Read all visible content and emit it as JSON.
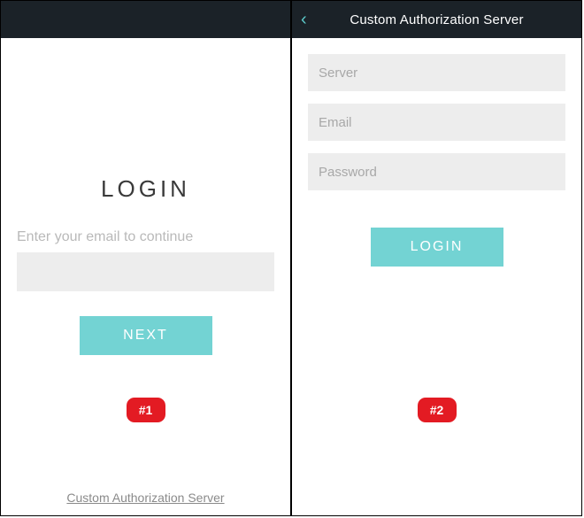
{
  "screen1": {
    "header": {
      "title": ""
    },
    "login_title": "LOGIN",
    "prompt_label": "Enter your email to continue",
    "email_input": {
      "value": "",
      "placeholder": ""
    },
    "next_button_label": "NEXT",
    "bottom_link_label": "Custom Authorization Server",
    "badge_label": "#1"
  },
  "screen2": {
    "header": {
      "title": "Custom Authorization Server",
      "back_icon": "‹"
    },
    "server_input": {
      "value": "",
      "placeholder": "Server"
    },
    "email_input": {
      "value": "",
      "placeholder": "Email"
    },
    "password_input": {
      "value": "",
      "placeholder": "Password"
    },
    "login_button_label": "LOGIN",
    "badge_label": "#2"
  },
  "colors": {
    "header_bg": "#1b2228",
    "accent": "#73d3d3",
    "chevron": "#5cc9c9",
    "input_bg": "#ededed",
    "badge_bg": "#e31b23"
  }
}
